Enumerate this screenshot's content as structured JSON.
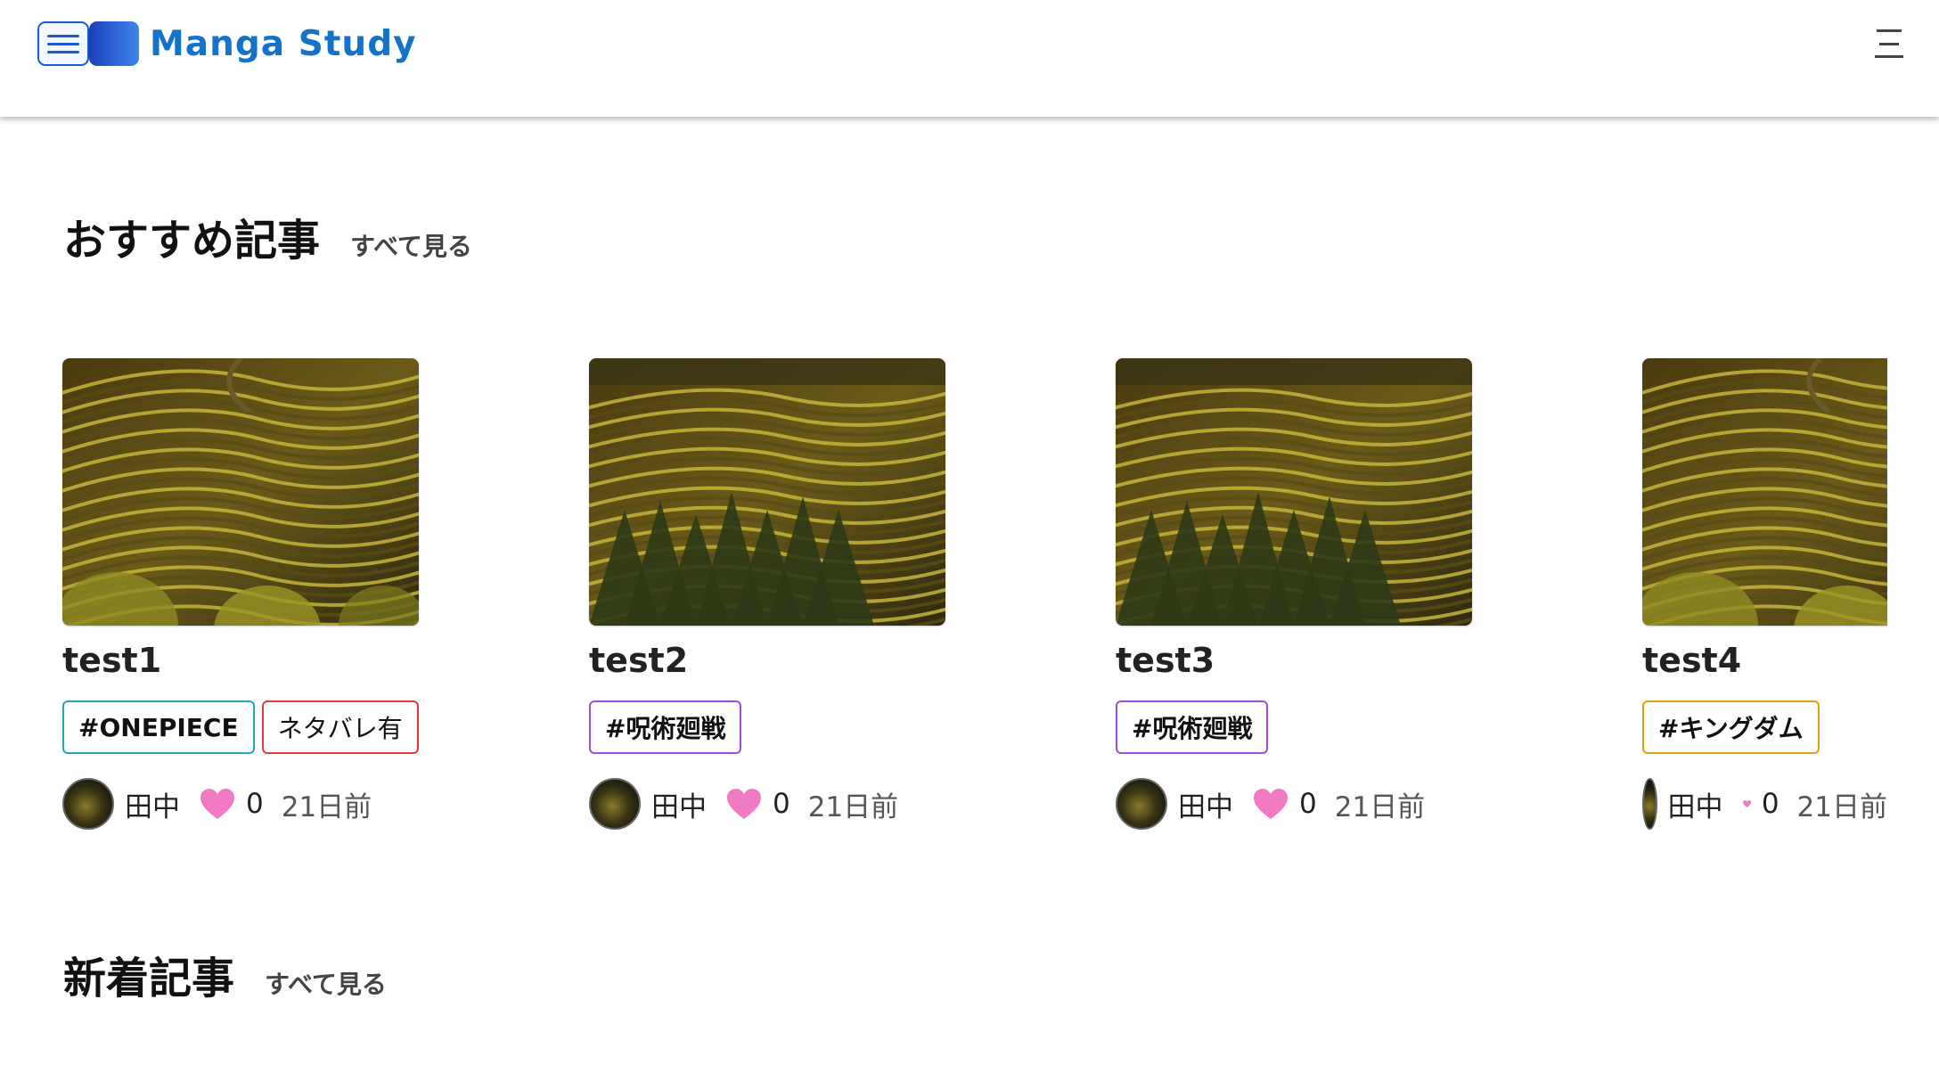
{
  "header": {
    "brand": "Manga Study"
  },
  "recommended": {
    "title": "おすすめ記事",
    "see_all": "すべて見る",
    "cards": [
      {
        "title": "test1",
        "image": "vineyard-hillside",
        "tags": [
          {
            "label": "#ONEPIECE",
            "color": "#22a6c6",
            "style": "bold"
          },
          {
            "label": "ネタバレ有",
            "color": "#e53a3a",
            "style": "plain"
          }
        ],
        "author": "田中",
        "likes": "0",
        "date": "21日前"
      },
      {
        "title": "test2",
        "image": "vineyard-forest",
        "tags": [
          {
            "label": "#呪術廻戦",
            "color": "#a04ae0",
            "style": "bold"
          }
        ],
        "author": "田中",
        "likes": "0",
        "date": "21日前"
      },
      {
        "title": "test3",
        "image": "vineyard-forest",
        "tags": [
          {
            "label": "#呪術廻戦",
            "color": "#a04ae0",
            "style": "bold"
          }
        ],
        "author": "田中",
        "likes": "0",
        "date": "21日前"
      },
      {
        "title": "test4",
        "image": "vineyard-hillside",
        "tags": [
          {
            "label": "#キングダム",
            "color": "#e0a010",
            "style": "bold"
          }
        ],
        "author": "田中",
        "likes": "0",
        "date": "21日前"
      }
    ]
  },
  "new_articles": {
    "title": "新着記事",
    "see_all": "すべて見る"
  },
  "colors": {
    "brand": "#1572c9",
    "heart": "#f27ac2"
  },
  "icons": {
    "logo": "hamburger-book-logo",
    "menu": "hamburger-menu-icon",
    "like": "heart-icon"
  }
}
